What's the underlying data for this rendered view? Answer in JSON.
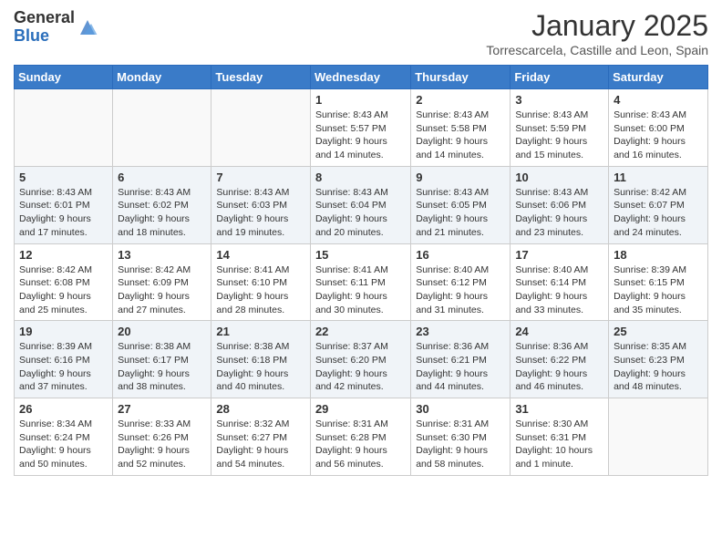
{
  "header": {
    "logo_general": "General",
    "logo_blue": "Blue",
    "month_title": "January 2025",
    "location": "Torrescarcela, Castille and Leon, Spain"
  },
  "weekdays": [
    "Sunday",
    "Monday",
    "Tuesday",
    "Wednesday",
    "Thursday",
    "Friday",
    "Saturday"
  ],
  "weeks": [
    [
      {
        "day": "",
        "info": ""
      },
      {
        "day": "",
        "info": ""
      },
      {
        "day": "",
        "info": ""
      },
      {
        "day": "1",
        "info": "Sunrise: 8:43 AM\nSunset: 5:57 PM\nDaylight: 9 hours\nand 14 minutes."
      },
      {
        "day": "2",
        "info": "Sunrise: 8:43 AM\nSunset: 5:58 PM\nDaylight: 9 hours\nand 14 minutes."
      },
      {
        "day": "3",
        "info": "Sunrise: 8:43 AM\nSunset: 5:59 PM\nDaylight: 9 hours\nand 15 minutes."
      },
      {
        "day": "4",
        "info": "Sunrise: 8:43 AM\nSunset: 6:00 PM\nDaylight: 9 hours\nand 16 minutes."
      }
    ],
    [
      {
        "day": "5",
        "info": "Sunrise: 8:43 AM\nSunset: 6:01 PM\nDaylight: 9 hours\nand 17 minutes."
      },
      {
        "day": "6",
        "info": "Sunrise: 8:43 AM\nSunset: 6:02 PM\nDaylight: 9 hours\nand 18 minutes."
      },
      {
        "day": "7",
        "info": "Sunrise: 8:43 AM\nSunset: 6:03 PM\nDaylight: 9 hours\nand 19 minutes."
      },
      {
        "day": "8",
        "info": "Sunrise: 8:43 AM\nSunset: 6:04 PM\nDaylight: 9 hours\nand 20 minutes."
      },
      {
        "day": "9",
        "info": "Sunrise: 8:43 AM\nSunset: 6:05 PM\nDaylight: 9 hours\nand 21 minutes."
      },
      {
        "day": "10",
        "info": "Sunrise: 8:43 AM\nSunset: 6:06 PM\nDaylight: 9 hours\nand 23 minutes."
      },
      {
        "day": "11",
        "info": "Sunrise: 8:42 AM\nSunset: 6:07 PM\nDaylight: 9 hours\nand 24 minutes."
      }
    ],
    [
      {
        "day": "12",
        "info": "Sunrise: 8:42 AM\nSunset: 6:08 PM\nDaylight: 9 hours\nand 25 minutes."
      },
      {
        "day": "13",
        "info": "Sunrise: 8:42 AM\nSunset: 6:09 PM\nDaylight: 9 hours\nand 27 minutes."
      },
      {
        "day": "14",
        "info": "Sunrise: 8:41 AM\nSunset: 6:10 PM\nDaylight: 9 hours\nand 28 minutes."
      },
      {
        "day": "15",
        "info": "Sunrise: 8:41 AM\nSunset: 6:11 PM\nDaylight: 9 hours\nand 30 minutes."
      },
      {
        "day": "16",
        "info": "Sunrise: 8:40 AM\nSunset: 6:12 PM\nDaylight: 9 hours\nand 31 minutes."
      },
      {
        "day": "17",
        "info": "Sunrise: 8:40 AM\nSunset: 6:14 PM\nDaylight: 9 hours\nand 33 minutes."
      },
      {
        "day": "18",
        "info": "Sunrise: 8:39 AM\nSunset: 6:15 PM\nDaylight: 9 hours\nand 35 minutes."
      }
    ],
    [
      {
        "day": "19",
        "info": "Sunrise: 8:39 AM\nSunset: 6:16 PM\nDaylight: 9 hours\nand 37 minutes."
      },
      {
        "day": "20",
        "info": "Sunrise: 8:38 AM\nSunset: 6:17 PM\nDaylight: 9 hours\nand 38 minutes."
      },
      {
        "day": "21",
        "info": "Sunrise: 8:38 AM\nSunset: 6:18 PM\nDaylight: 9 hours\nand 40 minutes."
      },
      {
        "day": "22",
        "info": "Sunrise: 8:37 AM\nSunset: 6:20 PM\nDaylight: 9 hours\nand 42 minutes."
      },
      {
        "day": "23",
        "info": "Sunrise: 8:36 AM\nSunset: 6:21 PM\nDaylight: 9 hours\nand 44 minutes."
      },
      {
        "day": "24",
        "info": "Sunrise: 8:36 AM\nSunset: 6:22 PM\nDaylight: 9 hours\nand 46 minutes."
      },
      {
        "day": "25",
        "info": "Sunrise: 8:35 AM\nSunset: 6:23 PM\nDaylight: 9 hours\nand 48 minutes."
      }
    ],
    [
      {
        "day": "26",
        "info": "Sunrise: 8:34 AM\nSunset: 6:24 PM\nDaylight: 9 hours\nand 50 minutes."
      },
      {
        "day": "27",
        "info": "Sunrise: 8:33 AM\nSunset: 6:26 PM\nDaylight: 9 hours\nand 52 minutes."
      },
      {
        "day": "28",
        "info": "Sunrise: 8:32 AM\nSunset: 6:27 PM\nDaylight: 9 hours\nand 54 minutes."
      },
      {
        "day": "29",
        "info": "Sunrise: 8:31 AM\nSunset: 6:28 PM\nDaylight: 9 hours\nand 56 minutes."
      },
      {
        "day": "30",
        "info": "Sunrise: 8:31 AM\nSunset: 6:30 PM\nDaylight: 9 hours\nand 58 minutes."
      },
      {
        "day": "31",
        "info": "Sunrise: 8:30 AM\nSunset: 6:31 PM\nDaylight: 10 hours\nand 1 minute."
      },
      {
        "day": "",
        "info": ""
      }
    ]
  ]
}
